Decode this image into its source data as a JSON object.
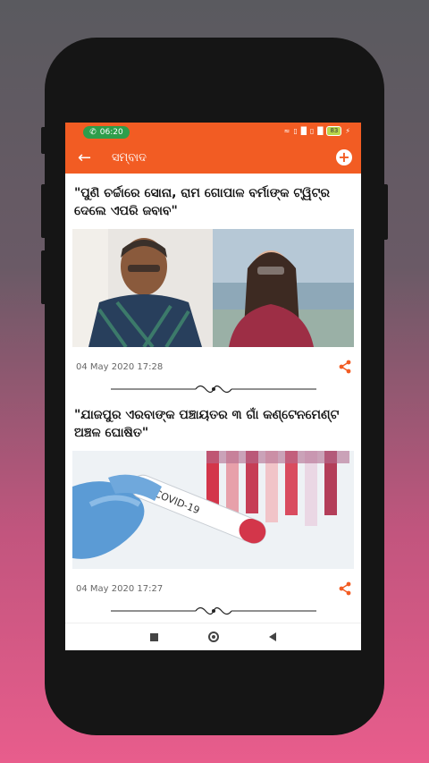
{
  "status_bar": {
    "time": "06:20",
    "battery": "83",
    "icons": [
      "wifi-icon",
      "volte-icon",
      "signal-icon",
      "volte-icon",
      "signal-icon",
      "battery-icon",
      "charging-icon"
    ]
  },
  "app_bar": {
    "title": "ସମ୍ବାଦ",
    "back_icon": "arrow-left-icon",
    "add_icon": "plus-circle-icon"
  },
  "articles": [
    {
      "headline": "\"ପୁଣି ଚର୍ଚ୍ଚାରେ ସୋନା, ରାମ ଗୋପାଳ ବର୍ମାଙ୍କ ଟ୍ୱିଟ୍‌ର ଦେଲେ ଏପରି ଜବାବ\"",
      "date": "04 May 2020 17:28"
    },
    {
      "headline": "\"ଯାଜପୁର ଏରବାଙ୍କ ପଞ୍ଚାୟତର ୩ ଗାଁ କଣ୍ଟେନମେଣ୍ଟ ଅଞ୍ଚଳ ଘୋଷିତ\"",
      "date": "04 May 2020 17:27",
      "image_text": "COVID-19"
    }
  ],
  "colors": {
    "accent": "#f25c23",
    "status_pill": "#2e9e4b",
    "share": "#f25c23"
  }
}
